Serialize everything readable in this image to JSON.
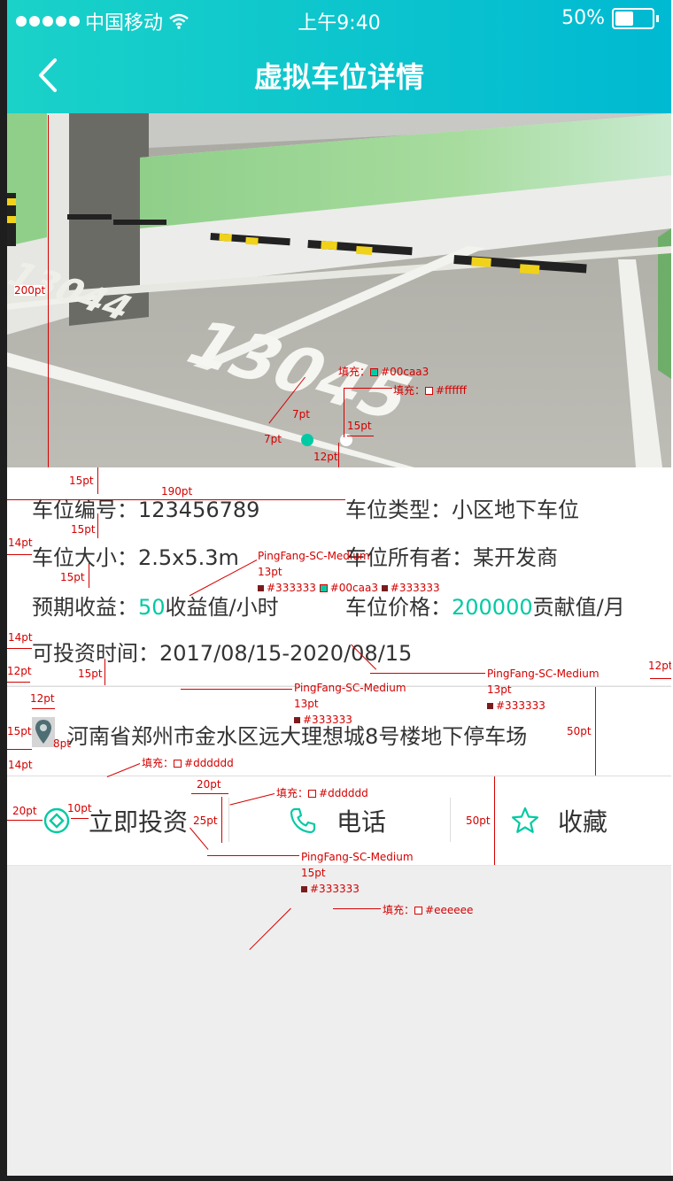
{
  "status_bar": {
    "carrier": "中国移动",
    "time": "上午9:40",
    "battery": "50%",
    "battery_level": 0.5
  },
  "nav": {
    "title": "虚拟车位详情"
  },
  "hero": {
    "slot_numbers": [
      "13044",
      "13045"
    ],
    "slides": 2,
    "active_slide": 0
  },
  "info": {
    "number_label": "车位编号：",
    "number_value": "123456789",
    "type_label": "车位类型：",
    "type_value": "小区地下车位",
    "size_label": "车位大小：",
    "size_value": "2.5x5.3m",
    "owner_label": "车位所有者：",
    "owner_value": "某开发商",
    "income_label": "预期收益：",
    "income_value": "50",
    "income_unit": "收益值/小时",
    "price_label": "车位价格：",
    "price_value": "200000",
    "price_unit": "贡献值/月",
    "time_label": "可投资时间：",
    "time_value": "2017/08/15-2020/08/15"
  },
  "address": {
    "text": "河南省郑州市金水区远大理想城8号楼地下停车场",
    "icon": "map-pin-icon"
  },
  "actions": {
    "invest": "立即投资",
    "phone": "电话",
    "favorite": "收藏"
  },
  "colors": {
    "accent": "#00caa3",
    "text": "#333333",
    "divider": "#dddddd",
    "background": "#eeeeee",
    "white": "#ffffff"
  },
  "annotations": {
    "hero_height": "200pt",
    "fill_accent": "填充：",
    "fill_accent_color": "#00caa3",
    "fill_white": "填充：",
    "fill_white_color": "#ffffff",
    "dot_w": "7pt",
    "dot_h": "7pt",
    "dot_gap": "15pt",
    "dot_bottom": "12pt",
    "row_gap1": "15pt",
    "col_x": "190pt",
    "row_gap2": "15pt",
    "left_pad": "14pt",
    "row_gap3": "15pt",
    "left_pad2": "14pt",
    "font1": "PingFang-SC-Medium",
    "font1_size": "13pt",
    "font1_c1": "#333333",
    "font1_c2": "#00caa3",
    "font1_c3": "#333333",
    "font2": "PingFang-SC-Medium",
    "font2_size": "13pt",
    "font2_c": "#333333",
    "right_pad": "12pt",
    "left_pad3": "12pt",
    "bottom_pad": "15pt",
    "font3": "PingFang-SC-Medium",
    "font3_size": "13pt",
    "font3_c": "#333333",
    "pin_w": "12pt",
    "pin_h": "15pt",
    "pin_gap": "8pt",
    "pin_left": "14pt",
    "addr_height": "50pt",
    "fill_divider": "填充：",
    "fill_divider_color": "#dddddd",
    "action_gap": "20pt",
    "fill_divider2": "填充：",
    "fill_divider2_color": "#dddddd",
    "action_left": "20pt",
    "icon_gap": "10pt",
    "sep_h": "25pt",
    "action_height": "50pt",
    "font4": "PingFang-SC-Medium",
    "font4_size": "15pt",
    "font4_c": "#333333",
    "fill_bg": "填充：",
    "fill_bg_color": "#eeeeee"
  }
}
